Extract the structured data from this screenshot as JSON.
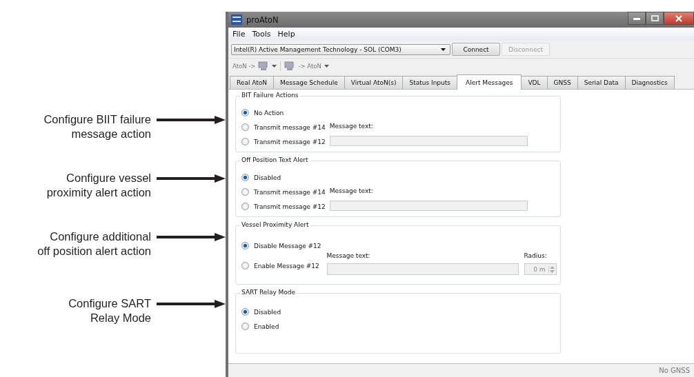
{
  "annotations": [
    {
      "text": "Configure BIIT failure\nmessage action"
    },
    {
      "text": "Configure vessel\nproximity alert action"
    },
    {
      "text": "Configure additional\noff position alert action"
    },
    {
      "text": "Configure SART\nRelay Mode"
    }
  ],
  "window": {
    "title": "proAtoN"
  },
  "menu": [
    "File",
    "Tools",
    "Help"
  ],
  "connection": {
    "port": "Intel(R) Active Management Technology - SOL (COM3)",
    "buttons": [
      {
        "label": "Connect",
        "disabled": false
      },
      {
        "label": "Disconnect",
        "disabled": true
      }
    ]
  },
  "toolbar": [
    {
      "label": "AtoN ->",
      "icon_first": false
    },
    {
      "label": "-> AtoN",
      "icon_first": true
    }
  ],
  "tabs": [
    {
      "label": "Real AtoN",
      "selected": false
    },
    {
      "label": "Message Schedule",
      "selected": false
    },
    {
      "label": "Virtual AtoN(s)",
      "selected": false
    },
    {
      "label": "Status Inputs",
      "selected": false
    },
    {
      "label": "Alert Messages",
      "selected": true
    },
    {
      "label": "VDL",
      "selected": false
    },
    {
      "label": "GNSS",
      "selected": false
    },
    {
      "label": "Serial Data",
      "selected": false
    },
    {
      "label": "Diagnostics",
      "selected": false
    }
  ],
  "groups": [
    {
      "kind": "message",
      "title": "BIT Failure Actions",
      "options": [
        {
          "label": "No Action",
          "selected": true
        },
        {
          "label": "Transmit message #14",
          "selected": false
        },
        {
          "label": "Transmit message #12",
          "selected": false
        }
      ],
      "message_label": "Message text:"
    },
    {
      "kind": "message",
      "title": "Off Position Text Alert",
      "options": [
        {
          "label": "Disabled",
          "selected": true
        },
        {
          "label": "Transmit message #14",
          "selected": false
        },
        {
          "label": "Transmit message #12",
          "selected": false
        }
      ],
      "message_label": "Message text:"
    },
    {
      "kind": "proximity",
      "title": "Vessel Proximity Alert",
      "options": [
        {
          "label": "Disable Message #12",
          "selected": true
        },
        {
          "label": "Enable Message #12",
          "selected": false
        }
      ],
      "message_label": "Message text:",
      "radius_label": "Radius:",
      "radius_value": "0 m"
    },
    {
      "kind": "plain",
      "title": "SART Relay Mode",
      "options": [
        {
          "label": "Disabled",
          "selected": true
        },
        {
          "label": "Enabled",
          "selected": false
        }
      ]
    }
  ],
  "status_bar": {
    "gnss": "No GNSS"
  }
}
